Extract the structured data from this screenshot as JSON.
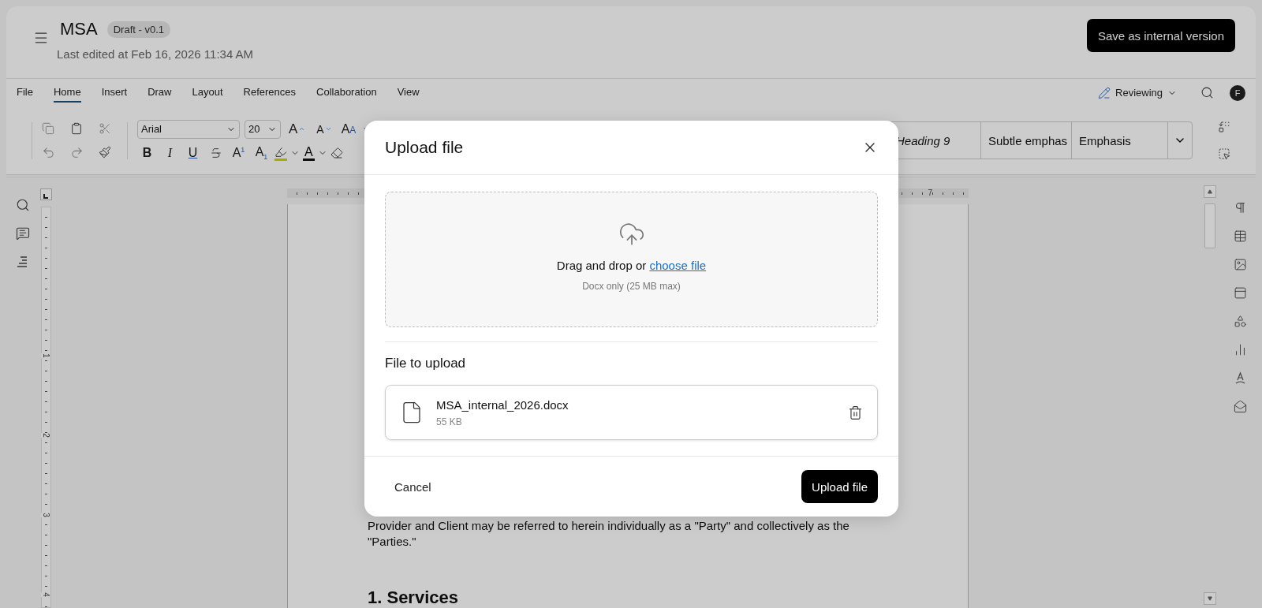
{
  "header": {
    "title": "MSA",
    "badge": "Draft - v0.1",
    "subtitle": "Last edited at Feb 16, 2026 11:34 AM",
    "save_button": "Save as internal version"
  },
  "menu_tabs": [
    {
      "label": "File",
      "selected": false
    },
    {
      "label": "Home",
      "selected": true
    },
    {
      "label": "Insert",
      "selected": false
    },
    {
      "label": "Draw",
      "selected": false
    },
    {
      "label": "Layout",
      "selected": false
    },
    {
      "label": "References",
      "selected": false
    },
    {
      "label": "Collaboration",
      "selected": false
    },
    {
      "label": "View",
      "selected": false
    }
  ],
  "mode_menu": "Reviewing",
  "avatar": "F",
  "toolbar": {
    "font": "Arial",
    "size": "20",
    "size_buttons": [
      {
        "label": "A",
        "kind": "grow"
      },
      {
        "label": "A",
        "kind": "shrink"
      }
    ],
    "case_button": "AA",
    "format_buttons": [
      {
        "label": "B",
        "kind": "bold"
      },
      {
        "label": "I",
        "kind": "italic"
      },
      {
        "label": "U",
        "kind": "underline"
      },
      {
        "kind": "strike"
      },
      {
        "label": "A$^{1}$",
        "kind": "plain"
      },
      {
        "label": "A$_{1}$",
        "kind": "plain"
      }
    ],
    "font_color_button": "A",
    "styles": [
      {
        "label": "Heading 9",
        "italic": true
      },
      {
        "label": "Subtle emphas",
        "italic": false
      },
      {
        "label": "Emphasis",
        "italic": false
      }
    ]
  },
  "horizontal_ruler": {
    "labels": [
      "7"
    ]
  },
  "vertical_ruler": {
    "labels": [
      "1",
      "2",
      "3",
      "4"
    ]
  },
  "document": {
    "paragraph": "Provider and Client may be referred to herein individually as a \"Party\" and collectively as the \"Parties.\"",
    "heading": "1. Services"
  },
  "dialog": {
    "title": "Upload file",
    "drop_text": "Drag and drop or ",
    "drop_link": "choose file",
    "hint": "Docx only (25 MB max)",
    "section_title": "File to upload",
    "file": {
      "name": "MSA_internal_2026.docx",
      "size": "55 KB"
    },
    "cancel": "Cancel",
    "submit": "Upload file"
  }
}
